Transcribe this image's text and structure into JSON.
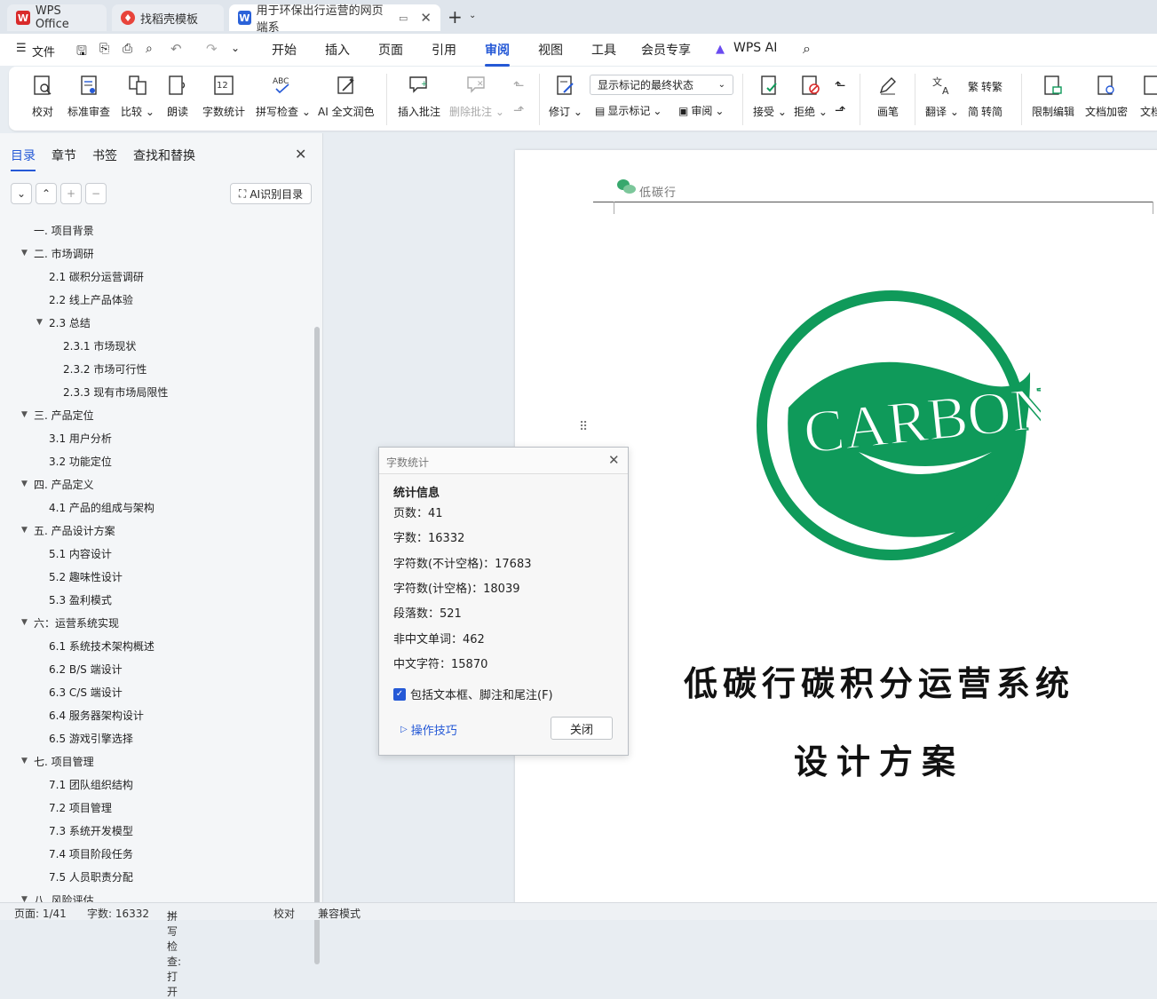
{
  "tabs": [
    {
      "label": "WPS Office",
      "icon": "wps-logo-icon",
      "color": "#d92b2b"
    },
    {
      "label": "找稻壳模板",
      "icon": "daoke-icon",
      "color": "#e8443b"
    },
    {
      "label": "用于环保出行运营的网页端系",
      "icon": "word-doc-icon",
      "color": "#2b62d9"
    }
  ],
  "menu": {
    "file": "文件",
    "items": [
      "开始",
      "插入",
      "页面",
      "引用",
      "审阅",
      "视图",
      "工具",
      "会员专享"
    ],
    "active": "审阅",
    "wps_ai": "WPS AI"
  },
  "ribbon": {
    "proofread": "校对",
    "std_review": "标准审查",
    "compare": "比较",
    "read_aloud": "朗读",
    "word_count": "字数统计",
    "spell_check": "拼写检查",
    "ai_polish": "AI 全文润色",
    "insert_comment": "插入批注",
    "delete_comment": "删除批注",
    "revise": "修订",
    "markup_select": "显示标记的最终状态",
    "show_markup": "显示标记",
    "review_pane": "审阅",
    "accept": "接受",
    "reject": "拒绝",
    "pen": "画笔",
    "translate": "翻译",
    "to_trad": "转繁",
    "to_simp": "转简",
    "restrict_edit": "限制编辑",
    "doc_encrypt": "文档加密",
    "doc_more": "文档"
  },
  "sidebar": {
    "tabs": [
      "目录",
      "章节",
      "书签",
      "查找和替换"
    ],
    "ai_toc": "AI识别目录",
    "toc": [
      {
        "label": "一. 项目背景",
        "level": 1,
        "arrow": false
      },
      {
        "label": "二. 市场调研",
        "level": 1,
        "arrow": true
      },
      {
        "label": "2.1  碳积分运营调研",
        "level": 2,
        "arrow": false
      },
      {
        "label": "2.2  线上产品体验",
        "level": 2,
        "arrow": false
      },
      {
        "label": "2.3  总结",
        "level": 2,
        "arrow": true
      },
      {
        "label": "2.3.1  市场现状",
        "level": 3,
        "arrow": false
      },
      {
        "label": "2.3.2  市场可行性",
        "level": 3,
        "arrow": false
      },
      {
        "label": "2.3.3  现有市场局限性",
        "level": 3,
        "arrow": false
      },
      {
        "label": "三. 产品定位",
        "level": 1,
        "arrow": true
      },
      {
        "label": "3.1  用户分析",
        "level": 2,
        "arrow": false
      },
      {
        "label": "3.2  功能定位",
        "level": 2,
        "arrow": false
      },
      {
        "label": "四. 产品定义",
        "level": 1,
        "arrow": true
      },
      {
        "label": "4.1  产品的组成与架构",
        "level": 2,
        "arrow": false
      },
      {
        "label": "五. 产品设计方案",
        "level": 1,
        "arrow": true
      },
      {
        "label": "5.1 内容设计",
        "level": 2,
        "arrow": false
      },
      {
        "label": "5.2  趣味性设计",
        "level": 2,
        "arrow": false
      },
      {
        "label": "5.3  盈利模式",
        "level": 2,
        "arrow": false
      },
      {
        "label": "六：运营系统实现",
        "level": 1,
        "arrow": true
      },
      {
        "label": "6.1  系统技术架构概述",
        "level": 2,
        "arrow": false
      },
      {
        "label": "6.2 B/S 端设计",
        "level": 2,
        "arrow": false
      },
      {
        "label": "6.3 C/S 端设计",
        "level": 2,
        "arrow": false
      },
      {
        "label": "6.4 服务器架构设计",
        "level": 2,
        "arrow": false
      },
      {
        "label": "6.5 游戏引擎选择",
        "level": 2,
        "arrow": false
      },
      {
        "label": "七. 项目管理",
        "level": 1,
        "arrow": true
      },
      {
        "label": "7.1  团队组织结构",
        "level": 2,
        "arrow": false
      },
      {
        "label": "7.2  项目管理",
        "level": 2,
        "arrow": false
      },
      {
        "label": "7.3  系统开发模型",
        "level": 2,
        "arrow": false
      },
      {
        "label": "7.4  项目阶段任务",
        "level": 2,
        "arrow": false
      },
      {
        "label": "7.5  人员职责分配",
        "level": 2,
        "arrow": false
      },
      {
        "label": "八. 风险评估",
        "level": 1,
        "arrow": true
      }
    ]
  },
  "document": {
    "header_text": "低碳行",
    "logo_text": "CARBON",
    "title_line1": "低碳行碳积分运营系统",
    "title_line2": "设计方案",
    "brand_color": "#0f9a5a"
  },
  "dialog": {
    "title": "字数统计",
    "heading": "统计信息",
    "stats": [
      "页数：41",
      "字数：16332",
      "字符数(不计空格)：17683",
      "字符数(计空格)：18039",
      "段落数：521",
      "非中文单词：462",
      "中文字符：15870"
    ],
    "checkbox_label": "包括文本框、脚注和尾注(F)",
    "checkbox_checked": true,
    "tips": "操作技巧",
    "close": "关闭"
  },
  "status": {
    "page": "页面: 1/41",
    "words": "字数: 16332",
    "spell": "拼写检查: 打开",
    "proof": "校对",
    "compat": "兼容模式"
  }
}
